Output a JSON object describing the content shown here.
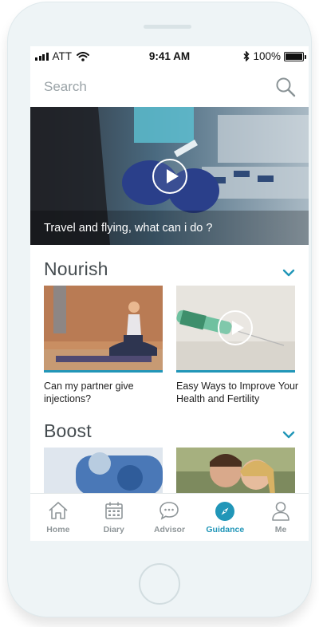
{
  "status_bar": {
    "carrier": "ATT",
    "time": "9:41 AM",
    "battery": "100%"
  },
  "search": {
    "placeholder": "Search"
  },
  "hero": {
    "caption": "Travel and flying, what can i do ?"
  },
  "sections": [
    {
      "title": "Nourish",
      "cards": [
        {
          "title": "Can my partner give injections?",
          "has_video": false
        },
        {
          "title": "Easy Ways to Improve Your Health and Fertility",
          "has_video": true
        }
      ]
    },
    {
      "title": "Boost",
      "cards": []
    }
  ],
  "tabs": [
    {
      "label": "Home",
      "icon": "house-icon",
      "active": false
    },
    {
      "label": "Diary",
      "icon": "calendar-icon",
      "active": false
    },
    {
      "label": "Advisor",
      "icon": "chat-bubble-icon",
      "active": false
    },
    {
      "label": "Guidance",
      "icon": "compass-icon",
      "active": true
    },
    {
      "label": "Me",
      "icon": "person-icon",
      "active": false
    }
  ],
  "colors": {
    "accent": "#2196b8",
    "tab_inactive": "#8f9699",
    "heading": "#444b4f"
  }
}
